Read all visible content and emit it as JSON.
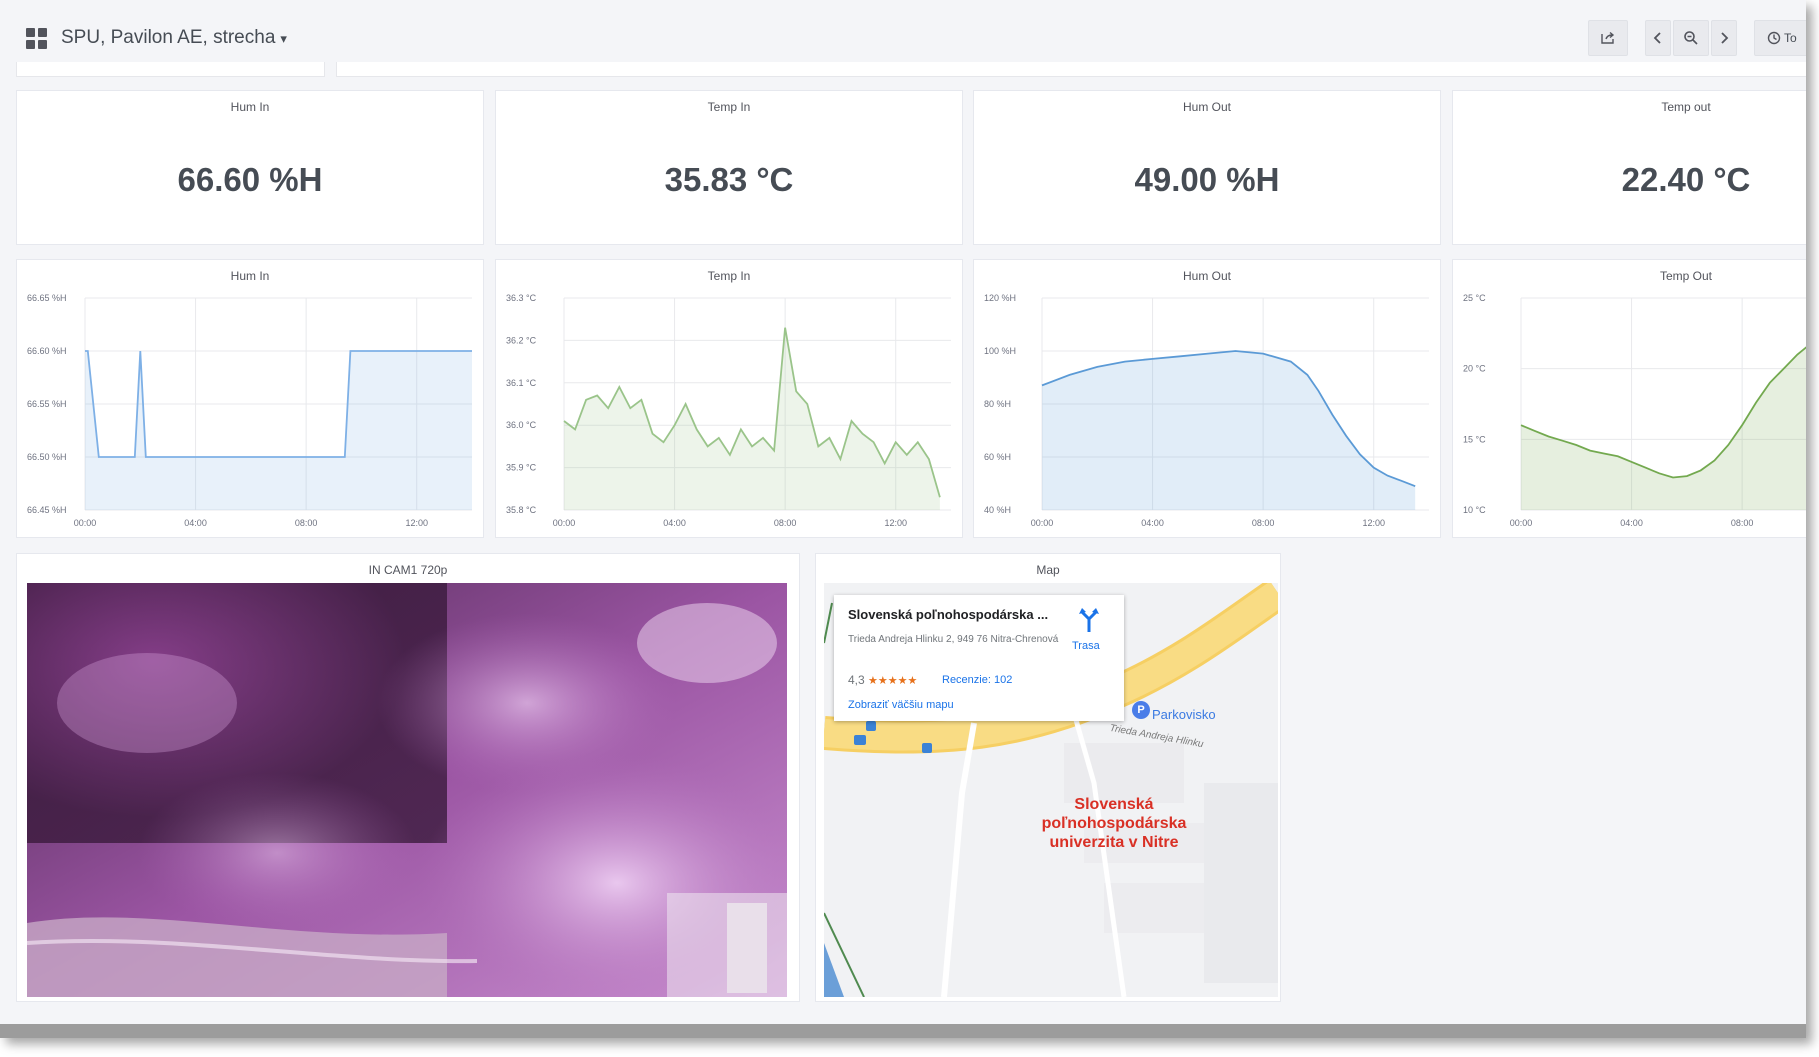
{
  "topbar": {
    "dashboard_title": "SPU, Pavilon AE, strecha",
    "time_label": "To"
  },
  "stats": [
    {
      "title": "Hum In",
      "value": "66.60 %H"
    },
    {
      "title": "Temp In",
      "value": "35.83 °C"
    },
    {
      "title": "Hum Out",
      "value": "49.00 %H"
    },
    {
      "title": "Temp out",
      "value": "22.40 °C"
    }
  ],
  "chart_data": [
    {
      "type": "area",
      "title": "Hum In",
      "y_ticks": [
        "66.65 %H",
        "66.60 %H",
        "66.55 %H",
        "66.50 %H",
        "66.45 %H"
      ],
      "x_ticks": [
        "00:00",
        "04:00",
        "08:00",
        "12:00"
      ],
      "ylim": [
        66.45,
        66.65
      ],
      "xlim": [
        0,
        14
      ],
      "color": "#7eb0e6",
      "x": [
        0,
        0.1,
        0.5,
        1.8,
        2.0,
        2.2,
        9.4,
        9.6,
        14
      ],
      "y": [
        66.6,
        66.6,
        66.5,
        66.5,
        66.6,
        66.5,
        66.5,
        66.6,
        66.6
      ]
    },
    {
      "type": "area",
      "title": "Temp In",
      "y_ticks": [
        "36.3 °C",
        "36.2 °C",
        "36.1 °C",
        "36.0 °C",
        "35.9 °C",
        "35.8 °C"
      ],
      "x_ticks": [
        "00:00",
        "04:00",
        "08:00",
        "12:00"
      ],
      "ylim": [
        35.8,
        36.3
      ],
      "xlim": [
        0,
        14
      ],
      "color": "#9ac48a",
      "x": [
        0,
        0.4,
        0.8,
        1.2,
        1.6,
        2.0,
        2.4,
        2.8,
        3.2,
        3.6,
        4.0,
        4.4,
        4.8,
        5.2,
        5.6,
        6.0,
        6.4,
        6.8,
        7.2,
        7.6,
        8.0,
        8.4,
        8.8,
        9.2,
        9.6,
        10.0,
        10.4,
        10.8,
        11.2,
        11.6,
        12.0,
        12.4,
        12.8,
        13.2,
        13.6
      ],
      "y": [
        36.01,
        35.99,
        36.06,
        36.07,
        36.04,
        36.09,
        36.04,
        36.06,
        35.98,
        35.96,
        36.0,
        36.05,
        35.99,
        35.95,
        35.97,
        35.93,
        35.99,
        35.95,
        35.97,
        35.94,
        36.23,
        36.08,
        36.05,
        35.95,
        35.97,
        35.92,
        36.01,
        35.98,
        35.96,
        35.91,
        35.96,
        35.93,
        35.96,
        35.92,
        35.83
      ]
    },
    {
      "type": "area",
      "title": "Hum Out",
      "y_ticks": [
        "120 %H",
        "100 %H",
        "80 %H",
        "60 %H",
        "40 %H"
      ],
      "x_ticks": [
        "00:00",
        "04:00",
        "08:00",
        "12:00"
      ],
      "ylim": [
        40,
        120
      ],
      "xlim": [
        0,
        14
      ],
      "color": "#5b9ad6",
      "x": [
        0,
        1,
        2,
        3,
        4,
        5,
        6,
        7,
        8,
        9,
        9.6,
        10,
        10.5,
        11,
        11.5,
        12,
        12.5,
        13,
        13.5
      ],
      "y": [
        87,
        91,
        94,
        96,
        97,
        98,
        99,
        100,
        99,
        96,
        91,
        85,
        76,
        68,
        61,
        56,
        53,
        51,
        49
      ]
    },
    {
      "type": "area",
      "title": "Temp Out",
      "y_ticks": [
        "25 °C",
        "20 °C",
        "15 °C",
        "10 °C"
      ],
      "x_ticks": [
        "00:00",
        "04:00",
        "08:00"
      ],
      "ylim": [
        10,
        25
      ],
      "xlim": [
        0,
        14
      ],
      "color": "#73a94f",
      "x": [
        0,
        0.5,
        1,
        1.5,
        2,
        2.5,
        3,
        3.5,
        4,
        4.5,
        5,
        5.5,
        6,
        6.5,
        7,
        7.5,
        8,
        8.5,
        9,
        9.5,
        10,
        10.5,
        11
      ],
      "y": [
        16.0,
        15.6,
        15.2,
        14.9,
        14.6,
        14.2,
        14.0,
        13.8,
        13.4,
        13.0,
        12.6,
        12.3,
        12.4,
        12.8,
        13.5,
        14.6,
        16.0,
        17.6,
        19.0,
        20.0,
        21.0,
        21.8,
        22.4
      ]
    }
  ],
  "camera": {
    "title": "IN CAM1 720p"
  },
  "map": {
    "title": "Map",
    "place_name": "Slovenská poľnohospodárska ...",
    "address": "Trieda Andreja Hlinku 2, 949 76 Nitra-Chrenová",
    "rating": "4,3",
    "stars": "★★★★★",
    "reviews": "Recenzie: 102",
    "bigger_map": "Zobraziť väčšiu mapu",
    "directions": "Trasa",
    "parking": "Parkovisko",
    "street": "Trieda Andreja Hlinku",
    "university_line1": "Slovenská",
    "university_line2": "poľnohospodárska",
    "university_line3": "univerzita v Nitre"
  }
}
